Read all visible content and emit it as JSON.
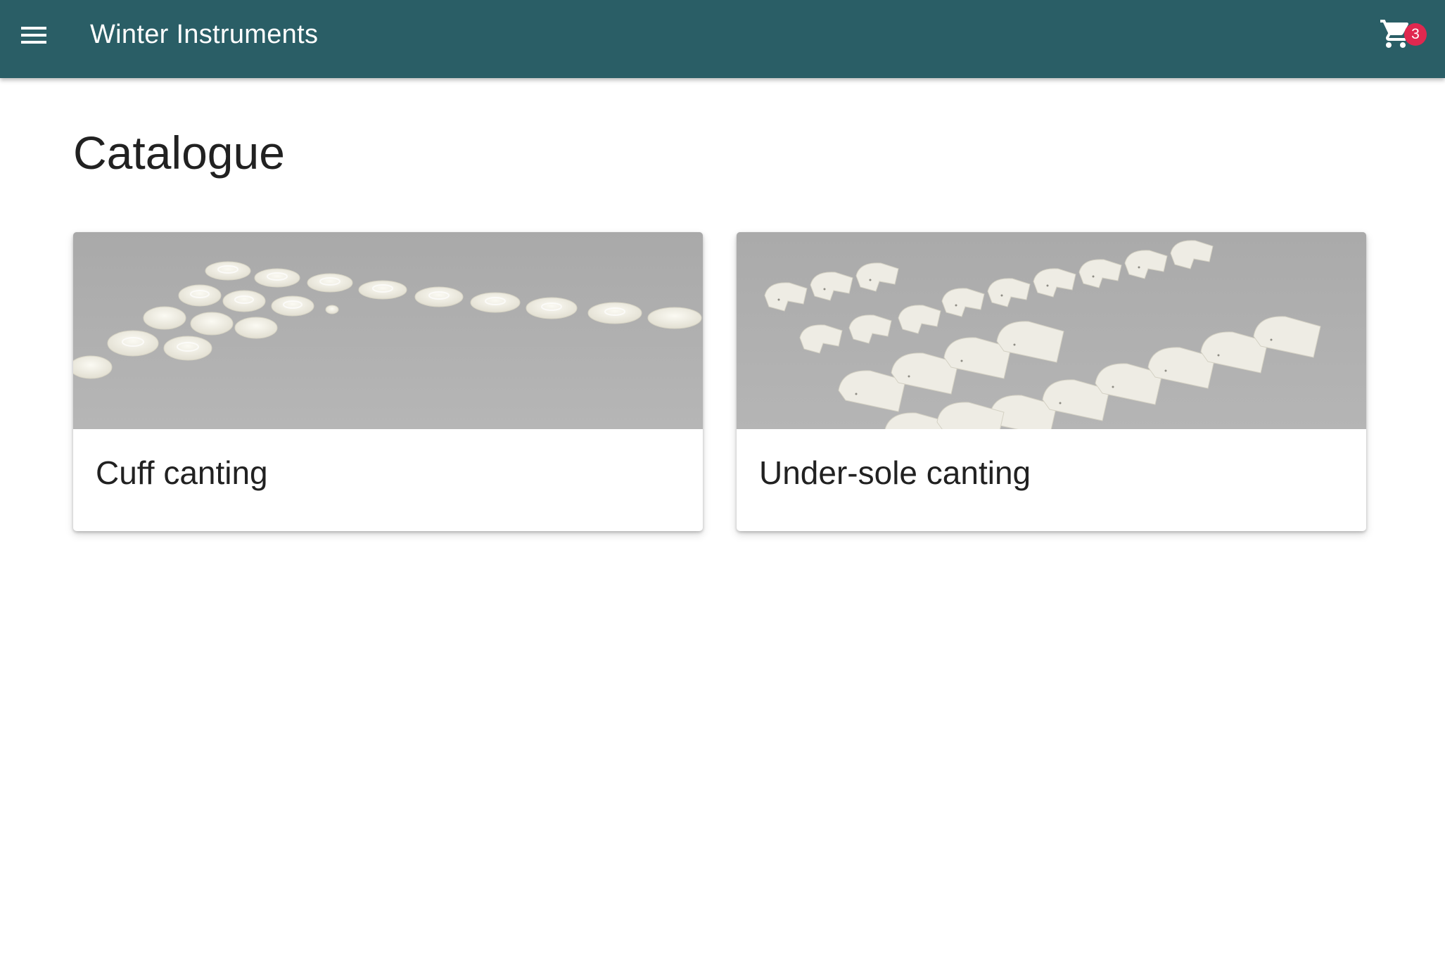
{
  "app_bar": {
    "menu_icon": "hamburger-menu-icon",
    "title": "Winter Instruments",
    "cart_icon": "shopping-cart-icon",
    "cart_count": "3",
    "colors": {
      "background": "#2a5e66",
      "badge": "#e0284f"
    }
  },
  "main": {
    "title": "Catalogue",
    "cards": [
      {
        "title": "Cuff canting"
      },
      {
        "title": "Under-sole canting"
      }
    ]
  }
}
